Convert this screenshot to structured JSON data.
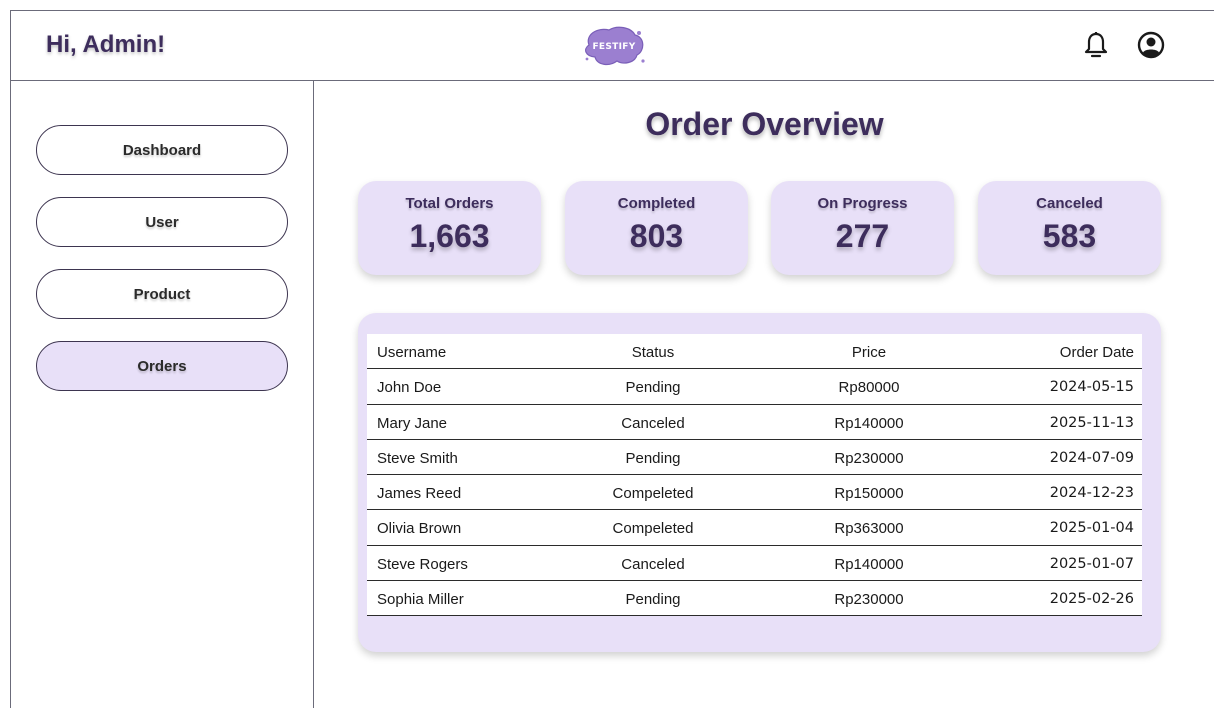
{
  "header": {
    "greeting": "Hi, Admin!",
    "logo_text": "FESTIFY",
    "icons": [
      "bell-icon",
      "user-circle-icon"
    ]
  },
  "sidebar": {
    "items": [
      {
        "label": "Dashboard",
        "active": false
      },
      {
        "label": "User",
        "active": false
      },
      {
        "label": "Product",
        "active": false
      },
      {
        "label": "Orders",
        "active": true
      }
    ]
  },
  "main": {
    "title": "Order Overview",
    "stats": [
      {
        "label": "Total Orders",
        "value": "1,663"
      },
      {
        "label": "Completed",
        "value": "803"
      },
      {
        "label": "On Progress",
        "value": "277"
      },
      {
        "label": "Canceled",
        "value": "583"
      }
    ],
    "table": {
      "columns": [
        "Username",
        "Status",
        "Price",
        "Order Date"
      ],
      "rows": [
        [
          "John Doe",
          "Pending",
          "Rp80000",
          "2024-05-15"
        ],
        [
          "Mary Jane",
          "Canceled",
          "Rp140000",
          "2025-11-13"
        ],
        [
          "Steve Smith",
          "Pending",
          "Rp230000",
          "2024-07-09"
        ],
        [
          "James Reed",
          "Compeleted",
          "Rp150000",
          "2024-12-23"
        ],
        [
          "Olivia Brown",
          "Compeleted",
          "Rp363000",
          "2025-01-04"
        ],
        [
          "Steve Rogers",
          "Canceled",
          "Rp140000",
          "2025-01-07"
        ],
        [
          "Sophia Miller",
          "Pending",
          "Rp230000",
          "2025-02-26"
        ]
      ]
    }
  },
  "colors": {
    "accent_lavender": "#e8e0f8",
    "title_purple": "#3d2d5c",
    "logo_purple": "#9b7fd0"
  }
}
